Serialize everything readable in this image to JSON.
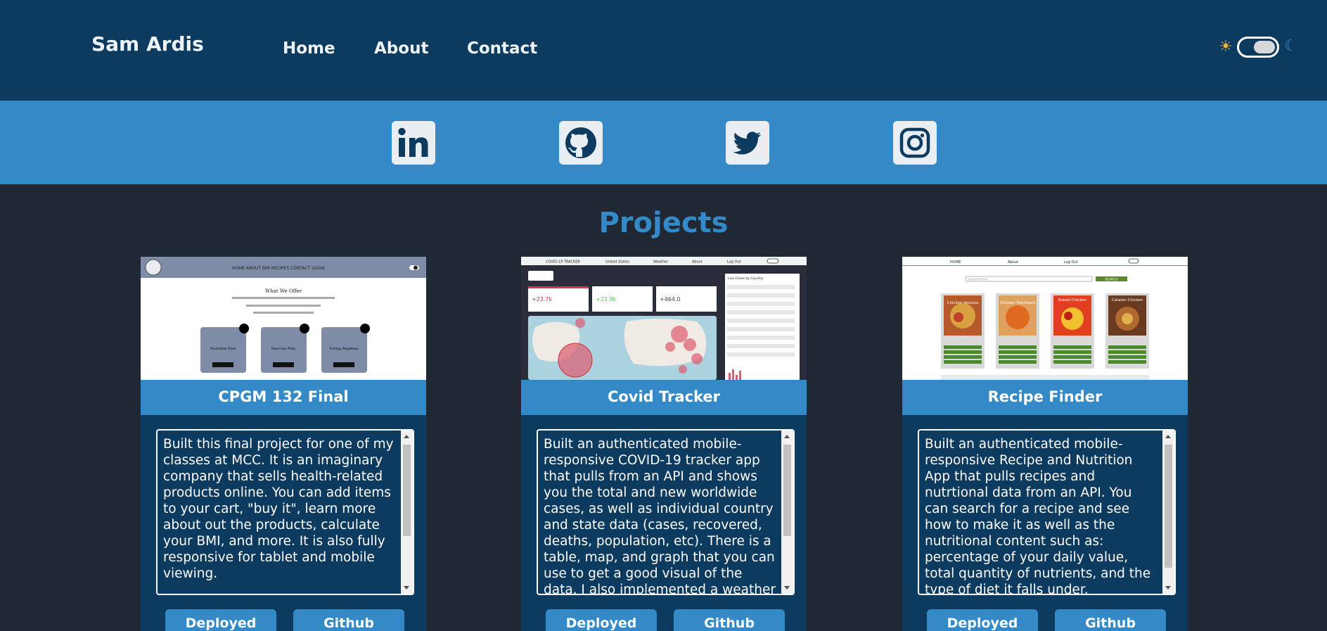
{
  "header": {
    "brand": "Sam Ardis",
    "nav": [
      "Home",
      "About",
      "Contact"
    ],
    "theme_toggle": {
      "state": "dark",
      "sun_icon": "☀",
      "moon_icon": "☾"
    }
  },
  "social": [
    {
      "icon": "linkedin-icon"
    },
    {
      "icon": "github-icon"
    },
    {
      "icon": "twitter-icon"
    },
    {
      "icon": "instagram-icon"
    }
  ],
  "projects": {
    "title": "Projects",
    "cards": [
      {
        "title": "CPGM 132 Final",
        "description": "Built this final project for one of my classes at MCC. It is an imaginary company that sells health-related products online. You can add items to your cart, \"buy it\", learn more about out the products, calculate your BMI, and more. It is also fully responsive for tablet and mobile viewing.",
        "deployed_label": "Deployed",
        "github_label": "Github",
        "thumb": {
          "nav": "HOME  ABOUT  BMI  RECIPES  CONTACT  LOGIN",
          "heading": "What We Offer",
          "items": [
            "Nutrition Plan",
            "Exercise Plan",
            "Eating Regimen"
          ]
        }
      },
      {
        "title": "Covid Tracker",
        "description": "Built an authenticated mobile-responsive COVID-19 tracker app that pulls from an API and shows you the total and new worldwide cases, as well as individual country and state data (cases, recovered, deaths, population, etc). There is a table, map, and graph that you can use to get a good visual of the data. I also implemented a weather tab so",
        "deployed_label": "Deployed",
        "github_label": "Github",
        "thumb": {
          "nav": [
            "COVID-19 TRACKER",
            "United States",
            "Weather",
            "About",
            "Log Out"
          ],
          "stats": [
            "+23.7k",
            "+23.9k",
            "+464.0"
          ],
          "table_title": "Live Cases by Country"
        }
      },
      {
        "title": "Recipe Finder",
        "description": "Built an authenticated mobile-responsive Recipe and Nutrition App that pulls recipes and nutrtional data from an API. You can search for a recipe and see how to make it as well as the nutritional content such as: percentage of your daily value, total quantity of nutrients, and the type of diet it falls under.",
        "deployed_label": "Deployed",
        "github_label": "Github",
        "thumb": {
          "nav": [
            "HOME",
            "About",
            "Log Out"
          ],
          "search_placeholder": "Search Food",
          "search_button": "SEARCH",
          "recipes": [
            "Chicken Vesuvio",
            "Chicken Paprikash",
            "Baked Chicken",
            "Catalan Chicken"
          ]
        }
      }
    ]
  },
  "colors": {
    "header_bg": "#0d3a5f",
    "accent": "#348ac7",
    "page_bg": "#1f2833"
  }
}
